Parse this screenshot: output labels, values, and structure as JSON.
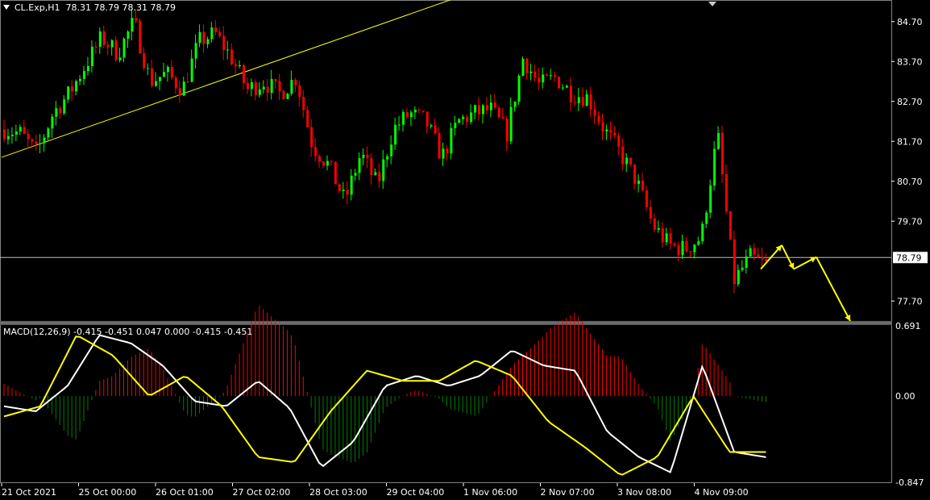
{
  "main_header": {
    "symbol": "CL.Exp,H1",
    "ohlc": "78.31 78.79 78.31 78.79"
  },
  "macd_header": "MACD(12,26,9) -0.415 -0.451 0.047 0.000 -0.415 -0.451",
  "current_price_label": "78.79",
  "colors": {
    "background": "#000000",
    "bull": "#00ff00",
    "bear": "#ff0000",
    "trendline": "#ffff00",
    "arrows": "#ffff00",
    "macd_line": "#ffffff",
    "signal_line": "#ffff00",
    "hist_pos": "#ff0000",
    "hist_neg": "#008000",
    "axis": "#ffffff",
    "price_line": "#c0c0c0"
  },
  "chart_data": [
    {
      "type": "candlestick",
      "symbol": "CL.Exp",
      "timeframe": "H1",
      "ylim": [
        77.2,
        85.2
      ],
      "y_ticks": [
        "84.70",
        "83.70",
        "82.70",
        "81.70",
        "80.70",
        "79.70",
        "77.70"
      ],
      "x_ticks": [
        "21 Oct 2021",
        "25 Oct 00:00",
        "26 Oct 01:00",
        "27 Oct 02:00",
        "28 Oct 03:00",
        "29 Oct 04:00",
        "1 Nov 06:00",
        "2 Nov 07:00",
        "3 Nov 08:00",
        "4 Nov 09:00"
      ],
      "close_path": [
        82.0,
        81.9,
        81.4,
        82.4,
        82.9,
        83.6,
        84.3,
        83.9,
        84.7,
        83.2,
        83.4,
        83.0,
        84.2,
        84.4,
        83.8,
        83.0,
        83.2,
        82.9,
        83.3,
        81.6,
        81.1,
        80.2,
        81.4,
        80.6,
        82.0,
        82.4,
        82.2,
        81.3,
        82.2,
        82.4,
        82.5,
        81.9,
        83.8,
        83.1,
        83.3,
        82.9,
        82.8,
        82.0,
        81.4,
        80.7,
        79.6,
        79.1,
        79.0,
        79.3,
        81.9,
        78.2,
        78.8,
        78.6
      ],
      "trendline": {
        "from": {
          "x": "21 Oct 2021",
          "y": 81.3
        },
        "to": {
          "x": "27 Oct 02:00",
          "y": 83.4
        }
      },
      "current_price": 78.79,
      "projection_arrows": [
        78.5,
        79.1,
        78.5,
        78.8,
        77.2
      ]
    },
    {
      "type": "macd",
      "title": "MACD(12,26,9)",
      "params": [
        12,
        26,
        9
      ],
      "values": {
        "macd": -0.415,
        "signal": -0.451,
        "histogram": 0.047
      },
      "ylim": [
        -0.847,
        0.691
      ],
      "y_ticks": [
        "0.691",
        "0.00",
        "-0.847"
      ],
      "macd_path": [
        -0.1,
        -0.15,
        0.1,
        0.6,
        0.52,
        0.3,
        -0.05,
        -0.1,
        0.15,
        -0.12,
        -0.7,
        -0.45,
        0.1,
        0.2,
        0.1,
        0.2,
        0.45,
        0.3,
        0.25,
        -0.35,
        -0.6,
        -0.75,
        0.3,
        -0.55,
        -0.6
      ],
      "signal_path": [
        -0.2,
        -0.1,
        0.6,
        0.4,
        0.0,
        0.2,
        -0.1,
        -0.6,
        -0.65,
        -0.15,
        0.25,
        0.15,
        0.15,
        0.35,
        0.2,
        -0.25,
        -0.5,
        -0.78,
        -0.6,
        0.0,
        -0.55,
        -0.55
      ]
    }
  ]
}
